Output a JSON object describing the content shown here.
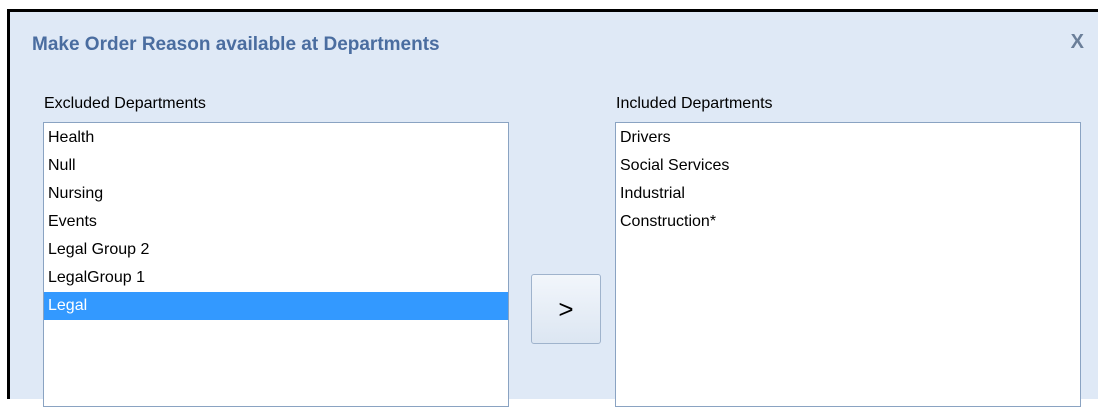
{
  "dialog": {
    "title": "Make Order Reason available at Departments",
    "close_label": "X"
  },
  "excluded": {
    "label": "Excluded Departments",
    "items": [
      "Health",
      "Null",
      "Nursing",
      "Events",
      "Legal Group 2",
      "LegalGroup 1",
      "Legal"
    ],
    "selected_index": 6
  },
  "included": {
    "label": "Included Departments",
    "items": [
      "Drivers",
      "Social Services",
      "Industrial",
      "Construction*"
    ]
  },
  "move_button": {
    "label": ">"
  },
  "colors": {
    "dialog_bg": "#dfe9f6",
    "title": "#4a6da0",
    "selection": "#3399ff"
  }
}
